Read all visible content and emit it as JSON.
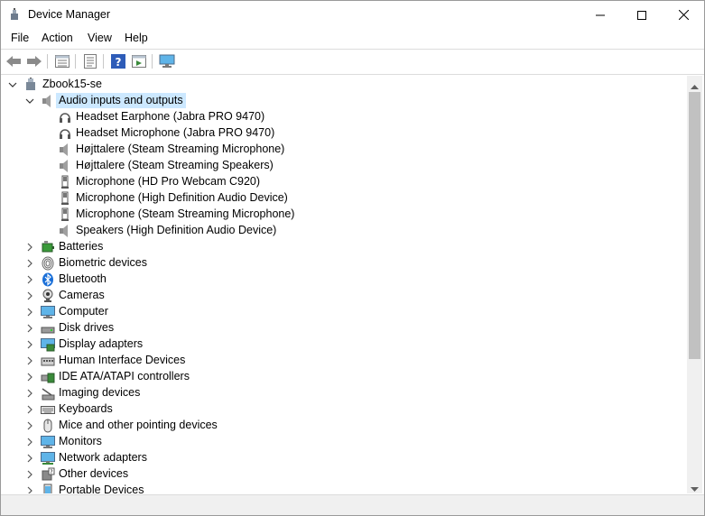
{
  "window": {
    "title": "Device Manager",
    "minimize_label": "",
    "maximize_label": "",
    "close_label": ""
  },
  "menu": {
    "items": [
      "File",
      "Action",
      "View",
      "Help"
    ]
  },
  "toolbar": {
    "buttons": [
      "back-icon",
      "forward-icon",
      "device-list-icon",
      "properties-icon",
      "help-icon",
      "run-icon",
      "monitor-icon"
    ]
  },
  "tree": {
    "root": "Zbook15-se",
    "expanded_category": "Audio inputs and outputs",
    "audio_devices": [
      "Headset Earphone (Jabra PRO 9470)",
      "Headset Microphone (Jabra PRO 9470)",
      "Højttalere (Steam Streaming Microphone)",
      "Højttalere (Steam Streaming Speakers)",
      "Microphone (HD Pro Webcam C920)",
      "Microphone (High Definition Audio Device)",
      "Microphone (Steam Streaming Microphone)",
      "Speakers (High Definition Audio Device)"
    ],
    "categories": [
      "Batteries",
      "Biometric devices",
      "Bluetooth",
      "Cameras",
      "Computer",
      "Disk drives",
      "Display adapters",
      "Human Interface Devices",
      "IDE ATA/ATAPI controllers",
      "Imaging devices",
      "Keyboards",
      "Mice and other pointing devices",
      "Monitors",
      "Network adapters",
      "Other devices",
      "Portable Devices"
    ]
  },
  "colors": {
    "selection": "#cce8ff",
    "accent": "#0078d7"
  }
}
